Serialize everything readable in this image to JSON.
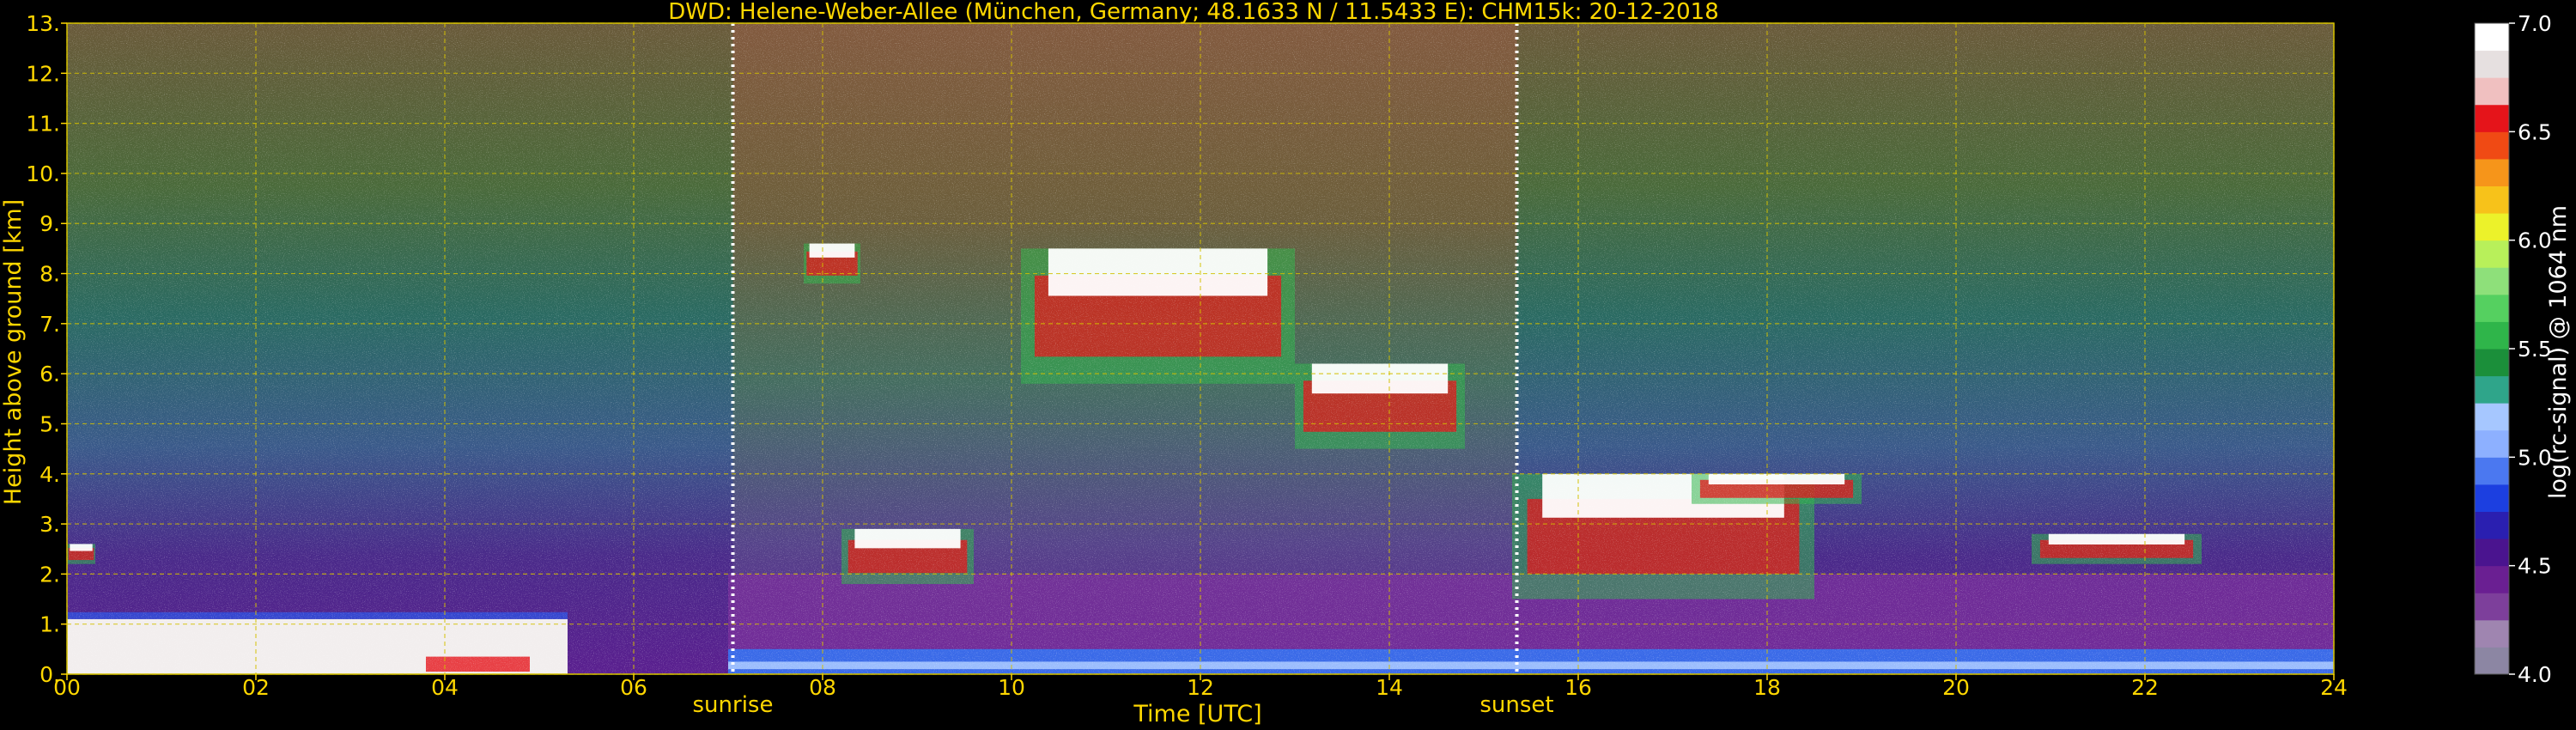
{
  "title": "DWD: Helene-Weber-Allee (München, Germany; 48.1633 N / 11.5433 E):    CHM15k: 20-12-2018",
  "xlabel": "Time [UTC]",
  "ylabel": "Height above ground [km]",
  "colorbar_label": "log(rc-signal) @ 1064 nm",
  "chart_data": {
    "type": "heatmap",
    "title": "DWD: Helene-Weber-Allee (München, Germany; 48.1633 N / 11.5433 E):    CHM15k: 20-12-2018",
    "xlabel": "Time [UTC]",
    "ylabel": "Height above ground [km]",
    "xlim": [
      0,
      24
    ],
    "ylim": [
      0,
      13
    ],
    "x_ticks": [
      0,
      2,
      4,
      6,
      8,
      10,
      12,
      14,
      16,
      18,
      20,
      22,
      24
    ],
    "x_tick_labels": [
      "00",
      "02",
      "04",
      "06",
      "08",
      "10",
      "12",
      "14",
      "16",
      "18",
      "20",
      "22",
      "24"
    ],
    "y_ticks": [
      0,
      1,
      2,
      3,
      4,
      5,
      6,
      7,
      8,
      9,
      10,
      11,
      12,
      13
    ],
    "y_tick_labels": [
      "0.",
      "1.",
      "2.",
      "3.",
      "4.",
      "5.",
      "6.",
      "7.",
      "8.",
      "9.",
      "10.",
      "11.",
      "12.",
      "13."
    ],
    "grid": true,
    "colorbar": {
      "label": "log(rc-signal) @ 1064 nm",
      "range": [
        4.0,
        7.0
      ],
      "ticks": [
        4.0,
        4.5,
        5.0,
        5.5,
        6.0,
        6.5,
        7.0
      ],
      "tick_labels": [
        "4.0",
        "4.5",
        "5.0",
        "5.5",
        "6.0",
        "6.5",
        "7.0"
      ],
      "colors": [
        "#8c86a3",
        "#9f85b0",
        "#7d3f9b",
        "#6a1f92",
        "#4a148f",
        "#2a1fb0",
        "#1c3fe0",
        "#4b78f0",
        "#8db0ff",
        "#a6c7ff",
        "#2fa58a",
        "#1b8f3a",
        "#2fb54a",
        "#55d060",
        "#8ee07a",
        "#b8f05a",
        "#ecf22a",
        "#f7c21a",
        "#f6951a",
        "#f04a14",
        "#e5141a",
        "#f0c0c0",
        "#e6e0e0",
        "#ffffff"
      ]
    },
    "event_markers": [
      {
        "label": "sunrise",
        "time": 7.05
      },
      {
        "label": "sunset",
        "time": 15.35
      }
    ],
    "cloud_layers": [
      {
        "t_start": 0.0,
        "t_end": 0.3,
        "z_bottom": 2.2,
        "z_top": 2.6
      },
      {
        "t_start": 7.8,
        "t_end": 8.4,
        "z_bottom": 7.8,
        "z_top": 8.6
      },
      {
        "t_start": 10.1,
        "t_end": 13.0,
        "z_bottom": 5.8,
        "z_top": 8.5
      },
      {
        "t_start": 13.0,
        "t_end": 14.8,
        "z_bottom": 4.5,
        "z_top": 6.2
      },
      {
        "t_start": 8.2,
        "t_end": 9.6,
        "z_bottom": 1.8,
        "z_top": 2.9
      },
      {
        "t_start": 15.3,
        "t_end": 18.5,
        "z_bottom": 1.5,
        "z_top": 4.0
      },
      {
        "t_start": 17.2,
        "t_end": 19.0,
        "z_bottom": 3.4,
        "z_top": 4.0
      },
      {
        "t_start": 20.8,
        "t_end": 22.6,
        "z_bottom": 2.2,
        "z_top": 2.8
      }
    ],
    "boundary_layer": [
      {
        "t_start": 0.0,
        "t_end": 5.3,
        "z_top": 1.1,
        "value": 6.6
      },
      {
        "t_start": 7.0,
        "t_end": 24.0,
        "z_top": 0.5,
        "value": 5.0
      }
    ]
  }
}
